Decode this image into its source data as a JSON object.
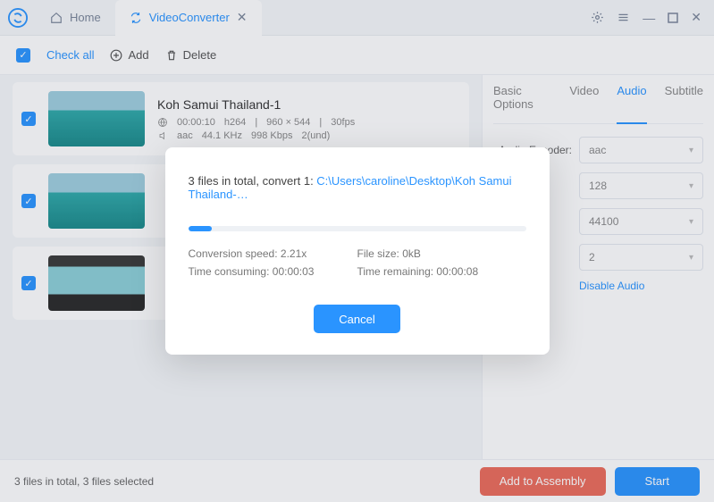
{
  "tabs": {
    "home": "Home",
    "converter": "VideoConverter"
  },
  "toolbar": {
    "check_all": "Check all",
    "add": "Add",
    "delete": "Delete"
  },
  "files": [
    {
      "title": "Koh Samui Thailand-1",
      "duration": "00:00:10",
      "vcodec": "h264",
      "resolution": "960 × 544",
      "fps": "30fps",
      "acodec": "aac",
      "arate": "44.1 KHz",
      "abitrate": "998 Kbps",
      "channels": "2(und)"
    },
    {
      "title": ""
    },
    {
      "title": ""
    }
  ],
  "options": {
    "tabs": {
      "basic": "Basic Options",
      "video": "Video",
      "audio": "Audio",
      "subtitle": "Subtitle"
    },
    "encoder_label": "Audio Encoder:",
    "encoder": "aac",
    "bitrate": "128",
    "samplerate": "44100",
    "channels": "2",
    "disable": "Disable Audio"
  },
  "footer": {
    "status": "3 files in total, 3 files selected",
    "assembly": "Add to Assembly",
    "start": "Start"
  },
  "modal": {
    "prefix": "3 files in total, convert 1: ",
    "path": "C:\\Users\\caroline\\Desktop\\Koh Samui Thailand-…",
    "speed_label": "Conversion speed: ",
    "speed": "2.21x",
    "consumed_label": "Time consuming: ",
    "consumed": "00:00:03",
    "size_label": "File size: ",
    "size": "0kB",
    "remain_label": "Time remaining: ",
    "remain": "00:00:08",
    "cancel": "Cancel"
  }
}
